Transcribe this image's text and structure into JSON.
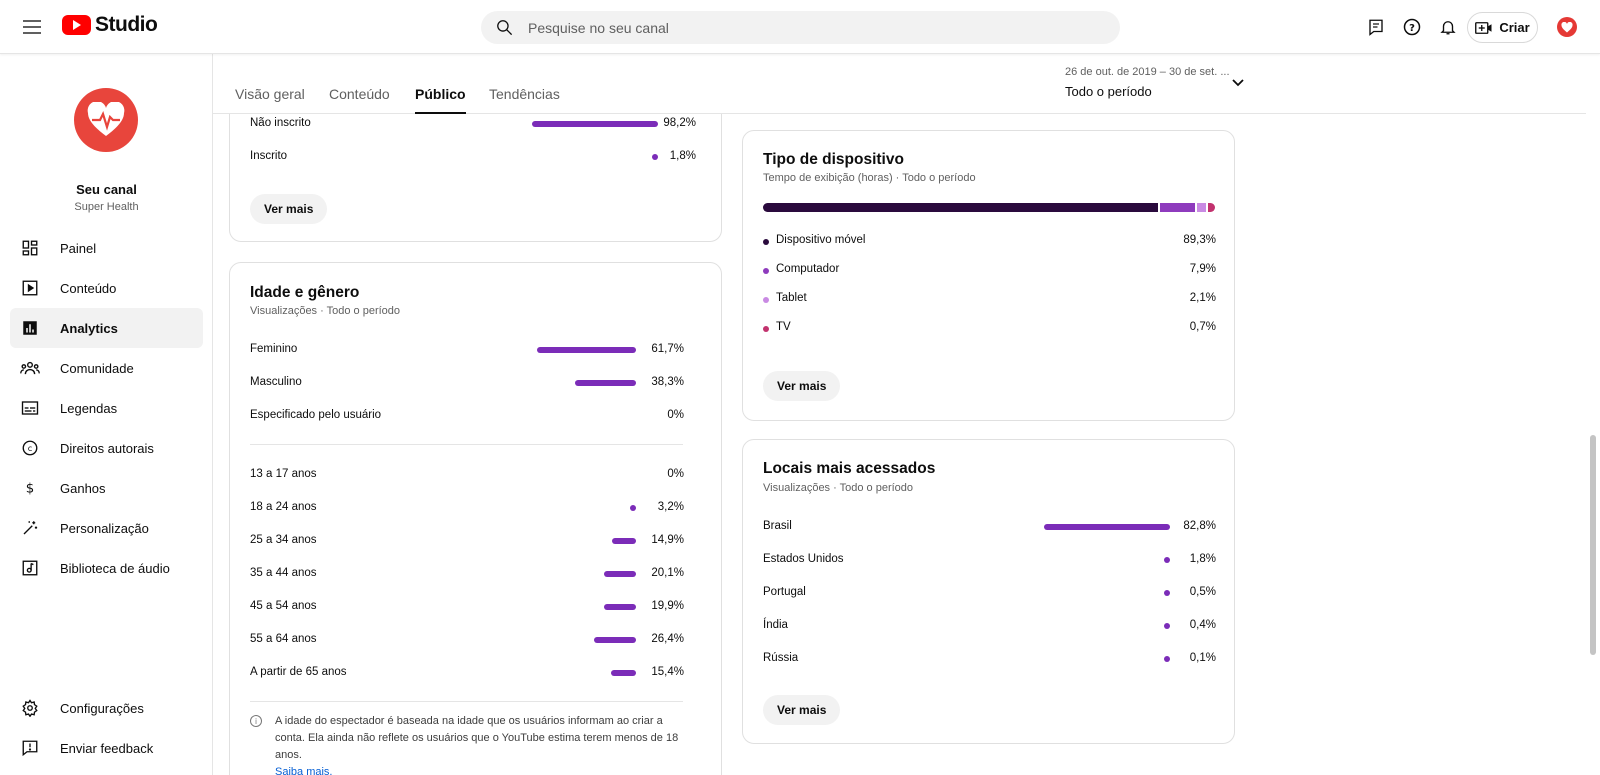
{
  "topbar": {
    "logo_text": "Studio",
    "search_placeholder": "Pesquise no seu canal",
    "create_label": "Criar"
  },
  "sidebar": {
    "channel_name": "Seu canal",
    "channel_subtitle": "Super Health",
    "items": [
      {
        "label": "Painel",
        "icon": "dashboard-icon"
      },
      {
        "label": "Conteúdo",
        "icon": "content-icon"
      },
      {
        "label": "Analytics",
        "icon": "analytics-icon"
      },
      {
        "label": "Comunidade",
        "icon": "community-icon"
      },
      {
        "label": "Legendas",
        "icon": "subtitles-icon"
      },
      {
        "label": "Direitos autorais",
        "icon": "copyright-icon"
      },
      {
        "label": "Ganhos",
        "icon": "earn-icon"
      },
      {
        "label": "Personalização",
        "icon": "customization-icon"
      },
      {
        "label": "Biblioteca de áudio",
        "icon": "audio-library-icon"
      }
    ],
    "bottom_items": [
      {
        "label": "Configurações",
        "icon": "settings-icon"
      },
      {
        "label": "Enviar feedback",
        "icon": "feedback-icon"
      }
    ]
  },
  "tabs": [
    {
      "label": "Visão geral"
    },
    {
      "label": "Conteúdo"
    },
    {
      "label": "Público"
    },
    {
      "label": "Tendências"
    }
  ],
  "date_picker": {
    "range": "26 de out. de 2019 – 30 de set. ...",
    "label": "Todo o período"
  },
  "subscription_card": {
    "rows": [
      {
        "label": "Não inscrito",
        "value": "98,2%",
        "fraction": 0.982
      },
      {
        "label": "Inscrito",
        "value": "1,8%",
        "fraction": 0.018
      }
    ],
    "see_more": "Ver mais"
  },
  "age_gender_card": {
    "title": "Idade e gênero",
    "subtitle": "Visualizações · Todo o período",
    "gender_rows": [
      {
        "label": "Feminino",
        "value": "61,7%",
        "fraction": 0.617
      },
      {
        "label": "Masculino",
        "value": "38,3%",
        "fraction": 0.383
      },
      {
        "label": "Especificado pelo usuário",
        "value": "0%",
        "fraction": 0
      }
    ],
    "age_rows": [
      {
        "label": "13 a 17 anos",
        "value": "0%",
        "fraction": 0
      },
      {
        "label": "18 a 24 anos",
        "value": "3,2%",
        "fraction": 0.032
      },
      {
        "label": "25 a 34 anos",
        "value": "14,9%",
        "fraction": 0.149
      },
      {
        "label": "35 a 44 anos",
        "value": "20,1%",
        "fraction": 0.201
      },
      {
        "label": "45 a 54 anos",
        "value": "19,9%",
        "fraction": 0.199
      },
      {
        "label": "55 a 64 anos",
        "value": "26,4%",
        "fraction": 0.264
      },
      {
        "label": "A partir de 65 anos",
        "value": "15,4%",
        "fraction": 0.154
      }
    ],
    "note": "A idade do espectador é baseada na idade que os usuários informam ao criar a conta. Ela ainda não reflete os usuários que o YouTube estima terem menos de 18 anos.",
    "note_link": "Saiba mais."
  },
  "device_card": {
    "title": "Tipo de dispositivo",
    "subtitle": "Tempo de exibição (horas) · Todo o período",
    "rows": [
      {
        "label": "Dispositivo móvel",
        "value": "89,3%",
        "fraction": 0.893,
        "color": "#2a0a3d"
      },
      {
        "label": "Computador",
        "value": "7,9%",
        "fraction": 0.079,
        "color": "#8e3bbd"
      },
      {
        "label": "Tablet",
        "value": "2,1%",
        "fraction": 0.021,
        "color": "#c98ae3"
      },
      {
        "label": "TV",
        "value": "0,7%",
        "fraction": 0.007,
        "color": "#c2326e"
      }
    ],
    "see_more": "Ver mais"
  },
  "locations_card": {
    "title": "Locais mais acessados",
    "subtitle": "Visualizações · Todo o período",
    "rows": [
      {
        "label": "Brasil",
        "value": "82,8%",
        "fraction": 0.828
      },
      {
        "label": "Estados Unidos",
        "value": "1,8%",
        "fraction": 0.018
      },
      {
        "label": "Portugal",
        "value": "0,5%",
        "fraction": 0.005
      },
      {
        "label": "Índia",
        "value": "0,4%",
        "fraction": 0.004
      },
      {
        "label": "Rússia",
        "value": "0,1%",
        "fraction": 0.001
      }
    ],
    "see_more": "Ver mais"
  },
  "colors": {
    "accent_bar": "#7b2cb8",
    "brand_red": "#ff0000"
  }
}
